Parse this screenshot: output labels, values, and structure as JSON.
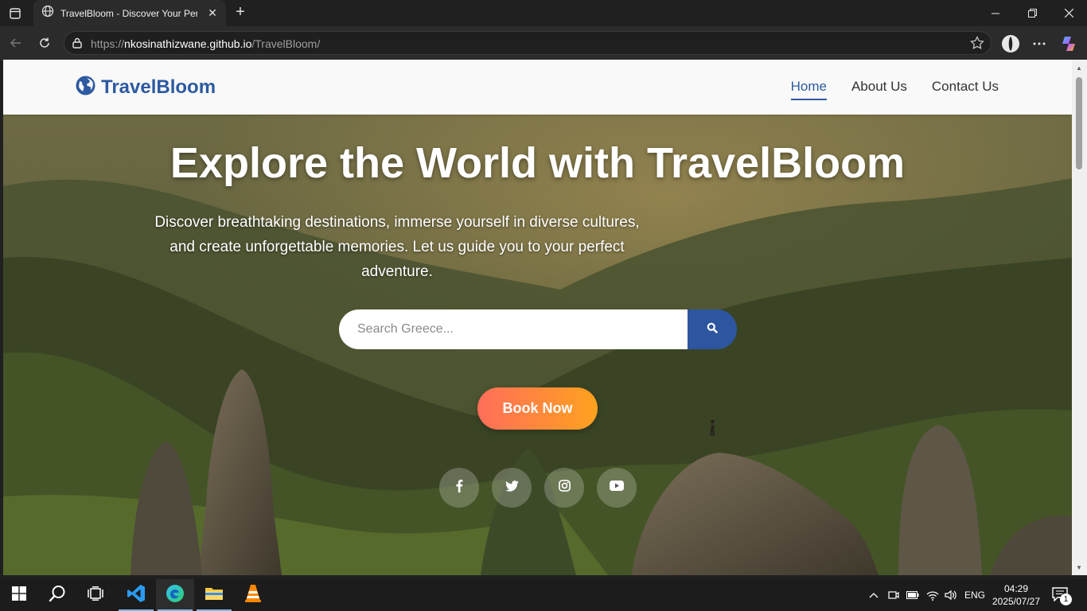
{
  "browser": {
    "tab_title": "TravelBloom - Discover Your Perfect Destination",
    "url_prefix": "https://",
    "url_host": "nkosinathizwane.github.io",
    "url_path": "/TravelBloom/"
  },
  "site": {
    "logo_text": "TravelBloom",
    "nav": [
      {
        "label": "Home",
        "active": true
      },
      {
        "label": "About Us",
        "active": false
      },
      {
        "label": "Contact Us",
        "active": false
      }
    ]
  },
  "hero": {
    "title": "Explore the World with TravelBloom",
    "subtitle": "Discover breathtaking destinations, immerse yourself in diverse cultures, and create unforgettable memories. Let us guide you to your perfect adventure.",
    "search_placeholder": "Search Greece...",
    "search_value": "",
    "book_label": "Book Now",
    "socials": [
      "facebook-icon",
      "twitter-icon",
      "instagram-icon",
      "youtube-icon"
    ]
  },
  "taskbar": {
    "lang": "ENG",
    "time": "04:29",
    "date": "2025/07/27",
    "notification_count": "1"
  },
  "colors": {
    "brand": "#2d5aa0",
    "button_gradient_start": "#ff6e5a",
    "button_gradient_end": "#ffa21e"
  }
}
